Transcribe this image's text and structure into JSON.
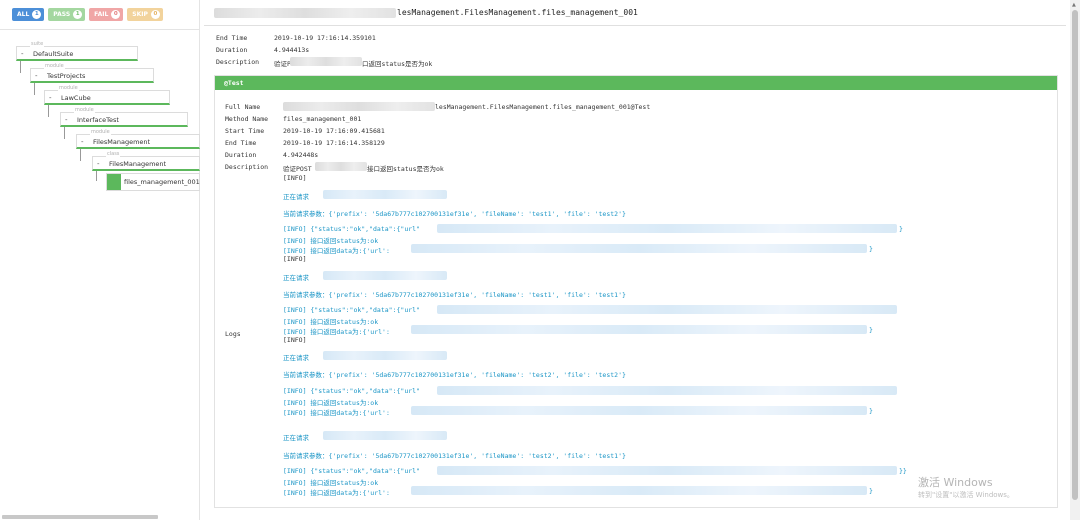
{
  "filters": [
    {
      "label": "ALL",
      "count": "1"
    },
    {
      "label": "PASS",
      "count": "1"
    },
    {
      "label": "FAIL",
      "count": "0"
    },
    {
      "label": "SKIP",
      "count": "0"
    }
  ],
  "tree": [
    {
      "type": "suite",
      "expander": "-",
      "name": "DefaultSuite"
    },
    {
      "type": "module",
      "expander": "-",
      "name": "TestProjects"
    },
    {
      "type": "module",
      "expander": "-",
      "name": "LawCube"
    },
    {
      "type": "module",
      "expander": "-",
      "name": "InterfaceTest"
    },
    {
      "type": "module",
      "expander": "-",
      "name": "FilesManagement"
    },
    {
      "type": "class",
      "expander": "-",
      "name": "FilesManagement"
    }
  ],
  "tree_leaf": {
    "name": "files_management_001",
    "status_color": "#5cb85c"
  },
  "report": {
    "title": "lesManagement.FilesManagement.files_management_001",
    "summary": {
      "end_time": {
        "key": "End Time",
        "value": "2019-10-19 17:16:14.359101"
      },
      "duration": {
        "key": "Duration",
        "value": "4.944413s"
      },
      "description": {
        "key": "Description",
        "value_prefix": "验证P",
        "value_suffix": "口返回status是否为ok"
      }
    },
    "test_header": "@Test",
    "details": {
      "full_name": {
        "key": "Full Name",
        "value": "lesManagement.FilesManagement.files_management_001@Test"
      },
      "method_name": {
        "key": "Method Name",
        "value": "files_management_001"
      },
      "start_time": {
        "key": "Start Time",
        "value": "2019-10-19 17:16:09.415681"
      },
      "end_time": {
        "key": "End Time",
        "value": "2019-10-19 17:16:14.358129"
      },
      "duration": {
        "key": "Duration",
        "value": "4.942448s"
      },
      "description": {
        "key": "Description",
        "value_prefix": "验证POST",
        "value_suffix": "接口返回status是否为ok"
      },
      "logs_key": "Logs"
    },
    "logs": {
      "info": "[INFO]",
      "requesting": "正在请求",
      "params_1": "当前请求参数：{'prefix': '5da67b777c102700131ef31e', 'fileName': 'test1', 'file': 'test2'}",
      "params_2": "当前请求参数：{'prefix': '5da67b777c102700131ef31e', 'fileName': 'test1', 'file': 'test1'}",
      "params_3": "当前请求参数：{'prefix': '5da67b777c102700131ef31e', 'fileName': 'test2', 'file': 'test2'}",
      "params_4": "当前请求参数：{'prefix': '5da67b777c102700131ef31e', 'fileName': 'test2', 'file': 'test1'}",
      "resp": "[INFO] {\"status\":\"ok\",\"data\":{\"url\"",
      "status_ok": "[INFO] 接口返回status为:ok",
      "data": "[INFO] 接口返回data为:{'url':",
      "brace": "}",
      "brace_double": "}}"
    }
  },
  "watermark": {
    "line1": "激活 Windows",
    "line2": "转到\"设置\"以激活 Windows。"
  },
  "colors": {
    "pass": "#5cb85c",
    "all": "#4c8fd8",
    "fail": "#f0a6a6",
    "skip": "#f2d39c",
    "log_blue": "#1a95c6"
  }
}
